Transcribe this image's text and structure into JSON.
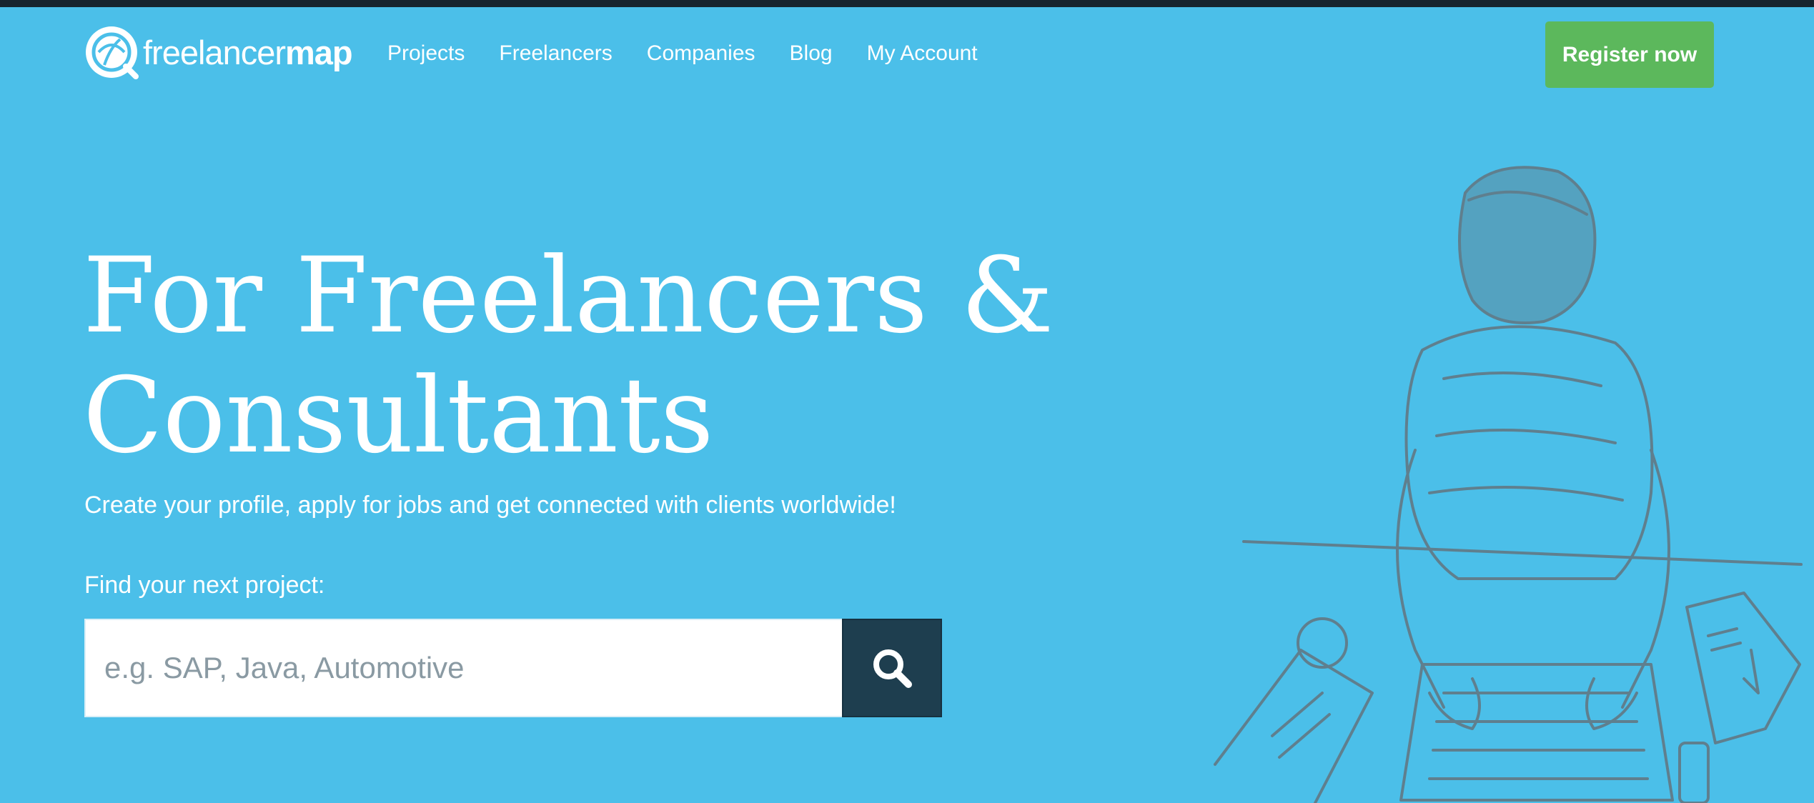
{
  "brand": {
    "logo_text_light": "freelancer",
    "logo_text_bold": "map",
    "logo_icon": "globe-logo-icon"
  },
  "nav": {
    "items": [
      {
        "label": "Projects"
      },
      {
        "label": "Freelancers"
      },
      {
        "label": "Companies"
      },
      {
        "label": "Blog"
      },
      {
        "label": "My Account"
      }
    ],
    "register_label": "Register now"
  },
  "hero": {
    "title_line1": "For Freelancers &",
    "title_line2": "Consultants",
    "subtitle": "Create your profile, apply for jobs and get connected with clients worldwide!",
    "find_label": "Find your next project:"
  },
  "search": {
    "placeholder": "e.g. SAP, Java, Automotive",
    "value": "",
    "button_icon": "search-icon"
  },
  "colors": {
    "background": "#4bbfe9",
    "top_strip": "#17242e",
    "register_button": "#5cb85c",
    "search_button": "#1e3e4f",
    "illustration_ink": "#5f7f8e"
  }
}
